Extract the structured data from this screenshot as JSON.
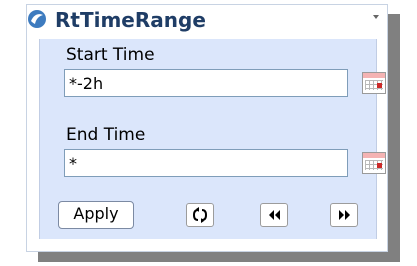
{
  "widget": {
    "title": "RtTimeRange",
    "logo_icon": "pi-logo-icon",
    "menu_icon": "chevron-down-icon"
  },
  "start": {
    "label": "Start Time",
    "value": "*-2h",
    "calendar_icon": "calendar-icon"
  },
  "end": {
    "label": "End Time",
    "value": "*",
    "calendar_icon": "calendar-icon"
  },
  "actions": {
    "apply_label": "Apply",
    "refresh_icon": "refresh-icon",
    "back_icon": "rewind-icon",
    "forward_icon": "fast-forward-icon"
  },
  "colors": {
    "title": "#1f3d66",
    "panel_body": "#dbe6fb",
    "logo": "#3d7bbf"
  }
}
